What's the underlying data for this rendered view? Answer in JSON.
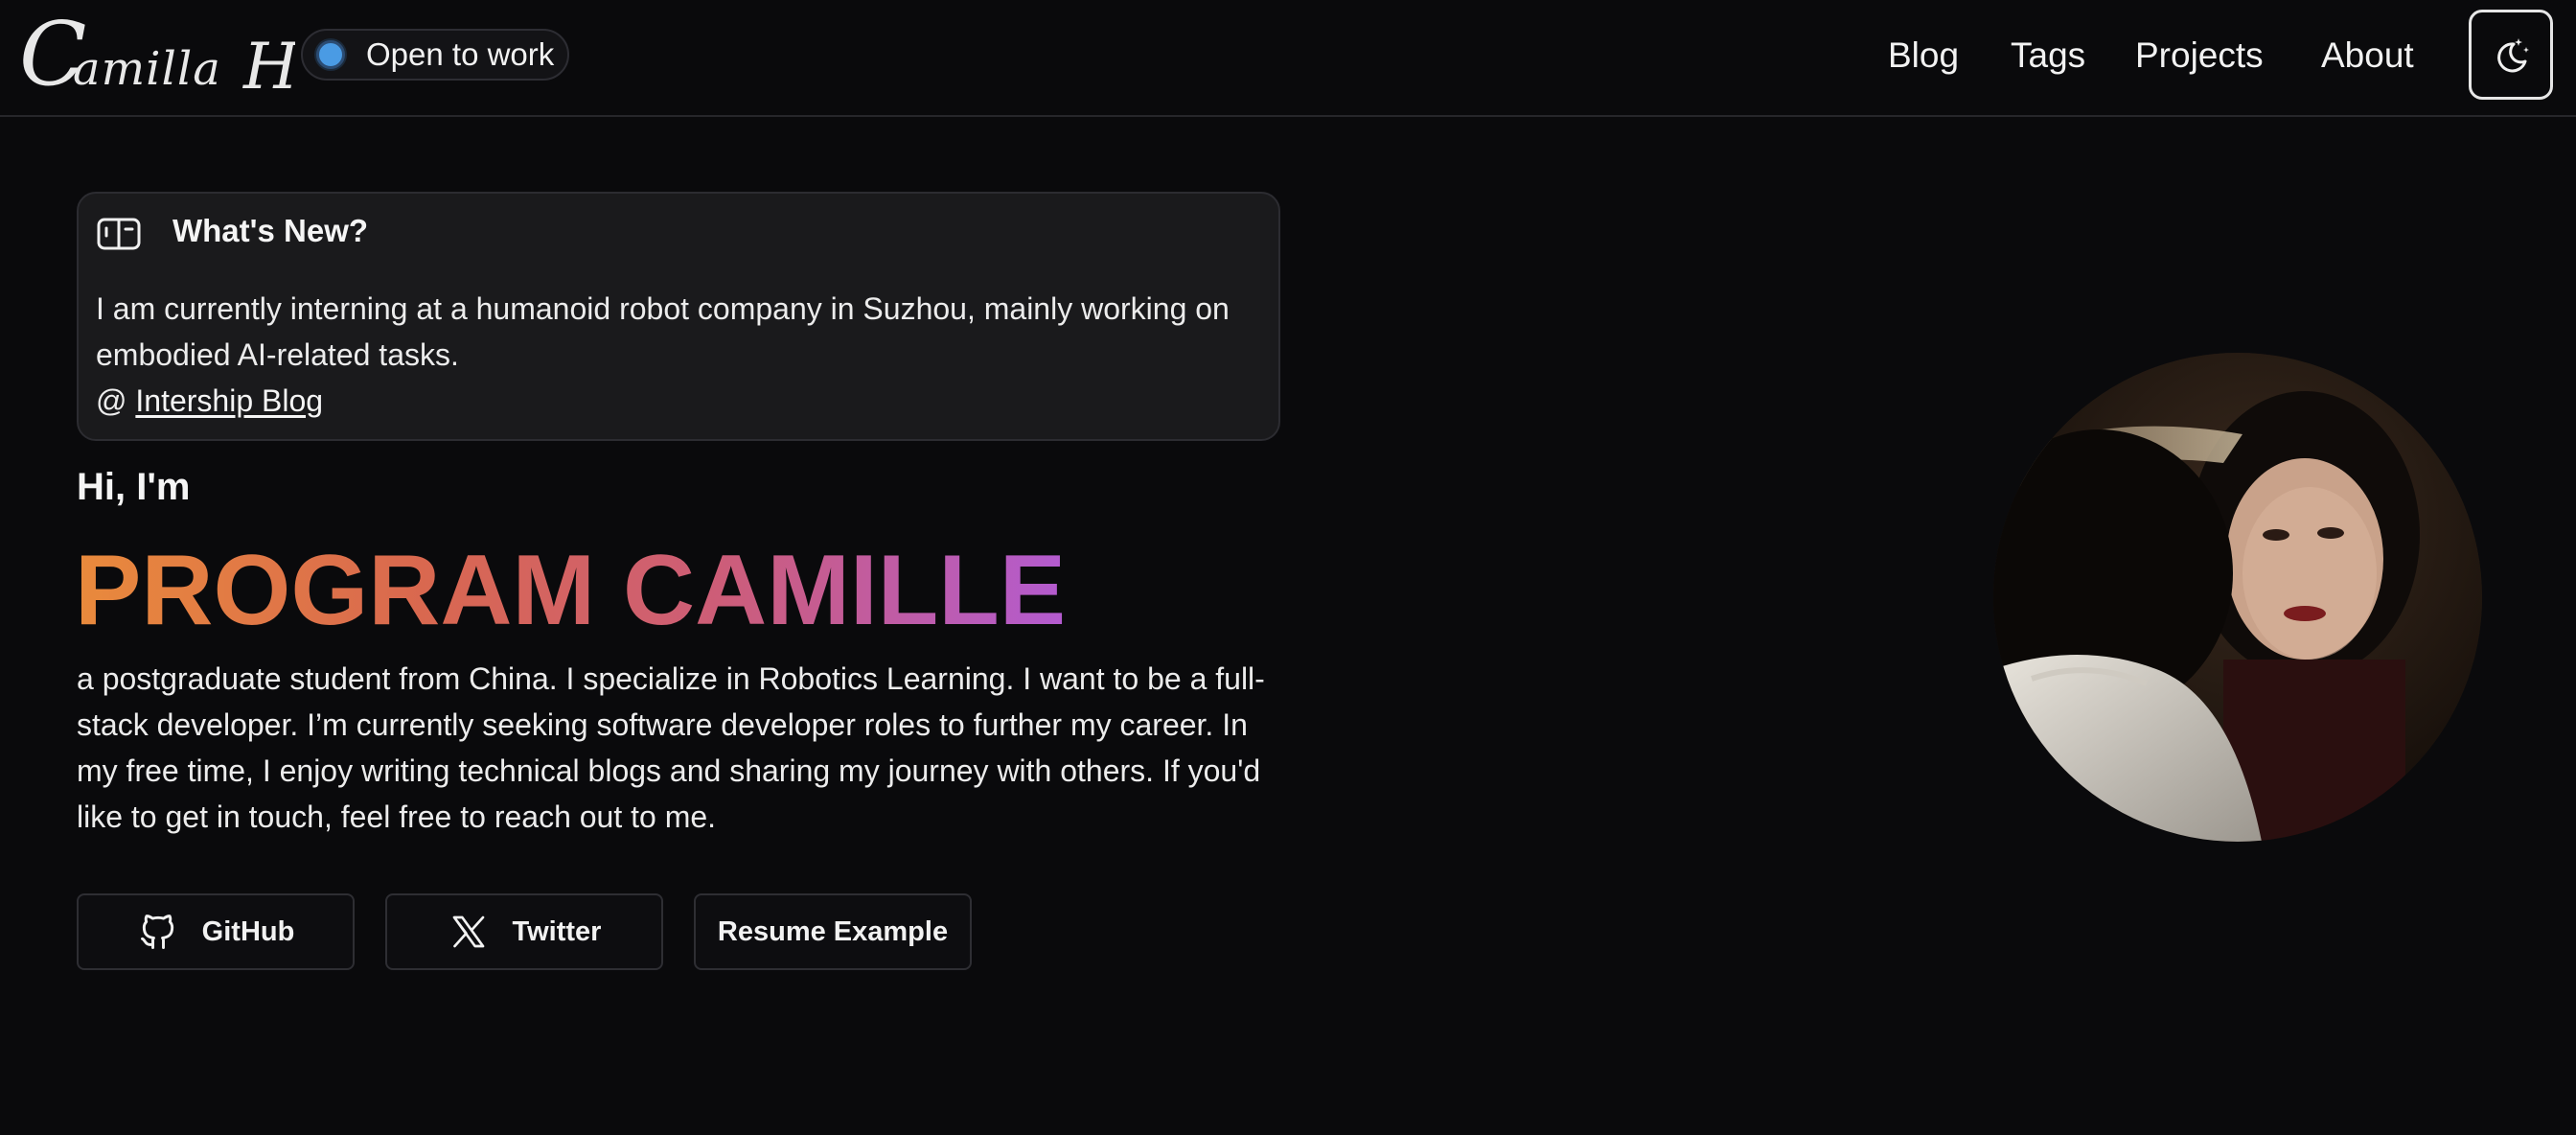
{
  "header": {
    "logo_text": "Camilla H",
    "status_text": "Open to work",
    "nav": [
      {
        "label": "Blog"
      },
      {
        "label": "Tags"
      },
      {
        "label": "Projects"
      },
      {
        "label": "About"
      }
    ],
    "theme_toggle_icon": "moon-stars-icon"
  },
  "news": {
    "icon": "news-panel-icon",
    "title": "What's New?",
    "body": "I am currently interning at a humanoid robot company in Suzhou, mainly working on embodied AI-related tasks.",
    "link_prefix": "@",
    "link_label": "Intership Blog"
  },
  "hero": {
    "greeting": "Hi, I'm",
    "name": "PROGRAM CAMILLE",
    "bio": "a postgraduate student from China. I specialize in Robotics Learning. I want to be a full-stack developer. I’m currently seeking software developer roles to further my career. In my free time, I enjoy writing technical blogs and sharing my journey with others. If you'd like to get in touch, feel free to reach out to me."
  },
  "buttons": [
    {
      "label": "GitHub",
      "icon": "github-icon"
    },
    {
      "label": "Twitter",
      "icon": "x-icon"
    },
    {
      "label": "Resume Example",
      "icon": ""
    }
  ],
  "colors": {
    "background": "#0a0a0c",
    "card": "#1a1a1c",
    "status_dot": "#4a9be4",
    "gradient_start": "#e98a3c",
    "gradient_end": "#b35bd0"
  },
  "avatar": {
    "alt": "profile photo"
  }
}
